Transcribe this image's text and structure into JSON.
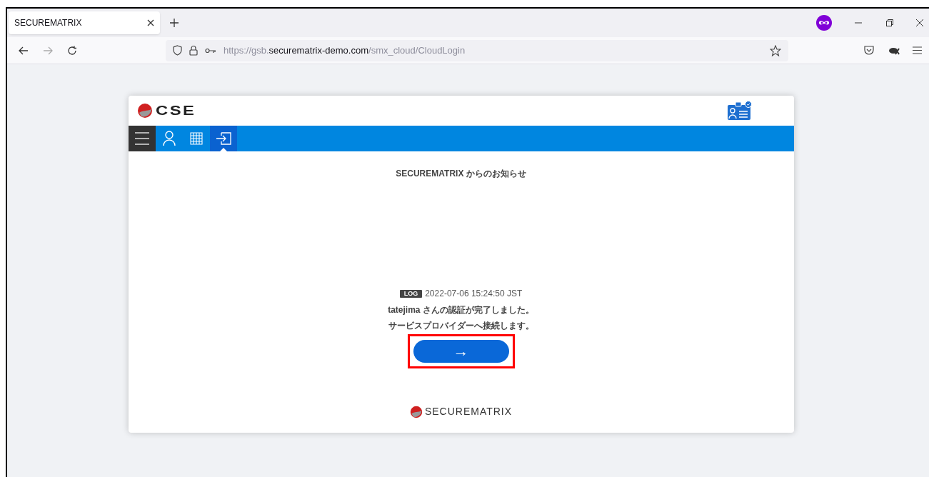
{
  "browser": {
    "tab": {
      "title": "SECUREMATRIX"
    },
    "url": {
      "scheme": "https://",
      "host_prefix": "gsb.",
      "host": "securematrix-demo.com",
      "path": "/smx_cloud/CloudLogin"
    }
  },
  "app": {
    "logo": "CSE",
    "nav": [
      {
        "kind": "menu",
        "selected": false
      },
      {
        "kind": "user",
        "selected": false
      },
      {
        "kind": "grid",
        "selected": false
      },
      {
        "kind": "login",
        "selected": true
      }
    ],
    "heading": "SECUREMATRIX からのお知らせ",
    "log": {
      "badge": "LOG",
      "time": "2022-07-06 15:24:50 JST"
    },
    "messages": [
      "tatejima さんの認証が完了しました。",
      "サービスプロバイダーへ接続します。"
    ],
    "continue_button": {
      "label": "→",
      "highlighted": true
    },
    "footer_logo": "SECUREMATRIX"
  }
}
